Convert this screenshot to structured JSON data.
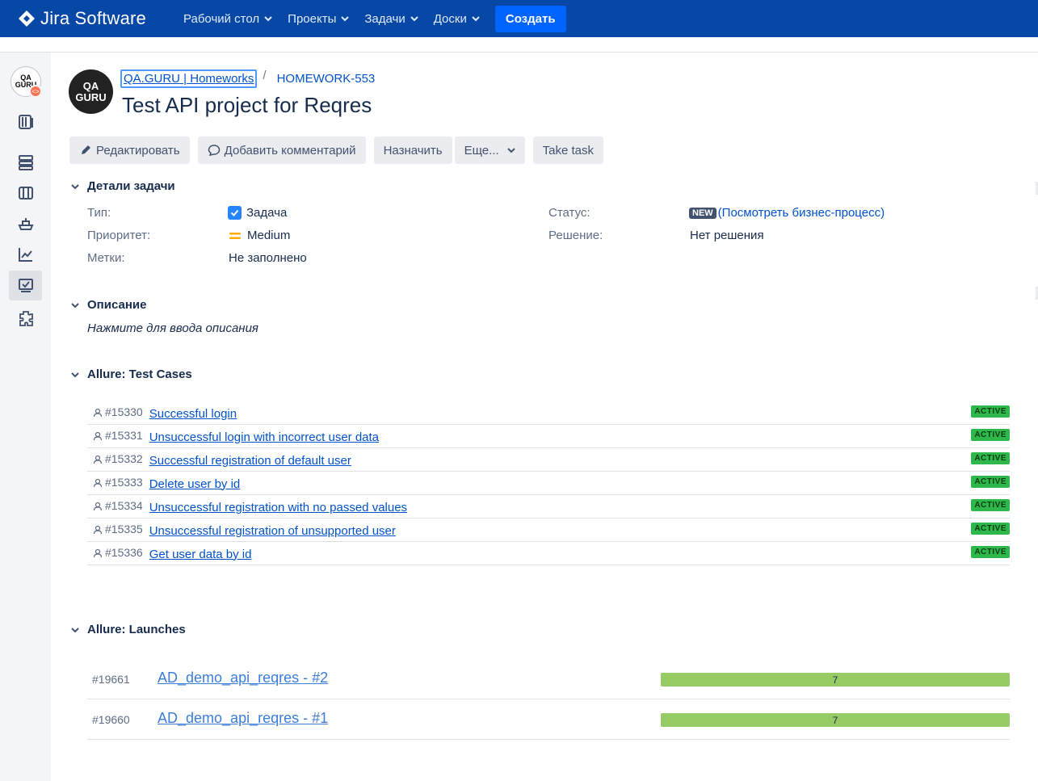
{
  "nav": {
    "brand": "Jira Software",
    "items": [
      {
        "label": "Рабочий стол"
      },
      {
        "label": "Проекты"
      },
      {
        "label": "Задачи"
      },
      {
        "label": "Доски"
      }
    ],
    "create_label": "Создать"
  },
  "sidebar": {
    "avatar_text": "QA GURU",
    "icons": [
      "backlog-icon",
      "releases-icon",
      "board-icon",
      "ship-icon",
      "reports-icon",
      "test-management-icon",
      "addon-icon"
    ]
  },
  "issue": {
    "project_avatar_text": "QA GURU",
    "breadcrumb": {
      "project": "QA.GURU | Homeworks",
      "separator": "/",
      "key": "HOMEWORK-553"
    },
    "title": "Test API project for Reqres"
  },
  "toolbar": {
    "edit_label": "Редактировать",
    "comment_label": "Добавить комментарий",
    "assign_label": "Назначить",
    "more_label": "Еще...",
    "take_task_label": "Take task"
  },
  "details": {
    "heading": "Детали задачи",
    "type_label": "Тип:",
    "type_value": "Задача",
    "priority_label": "Приоритет:",
    "priority_value": "Medium",
    "labels_label": "Метки:",
    "labels_value": "Не заполнено",
    "status_label": "Статус:",
    "status_value": "NEW",
    "workflow_link": "(Посмотреть бизнес-процесс)",
    "resolution_label": "Решение:",
    "resolution_value": "Нет решения"
  },
  "description": {
    "heading": "Описание",
    "placeholder": "Нажмите для ввода описания"
  },
  "test_cases": {
    "heading": "Allure: Test Cases",
    "items": [
      {
        "id": "#15330",
        "name": "Successful login",
        "status": "ACTIVE"
      },
      {
        "id": "#15331",
        "name": "Unsuccessful login with incorrect user data",
        "status": "ACTIVE"
      },
      {
        "id": "#15332",
        "name": "Successful registration of default user",
        "status": "ACTIVE"
      },
      {
        "id": "#15333",
        "name": "Delete user by id",
        "status": "ACTIVE"
      },
      {
        "id": "#15334",
        "name": "Unsuccessful registration with no passed values",
        "status": "ACTIVE"
      },
      {
        "id": "#15335",
        "name": "Unsuccessful registration of unsupported user",
        "status": "ACTIVE"
      },
      {
        "id": "#15336",
        "name": "Get user data by id",
        "status": "ACTIVE"
      }
    ]
  },
  "launches": {
    "heading": "Allure: Launches",
    "items": [
      {
        "id": "#19661",
        "name": "AD_demo_api_reqres - #2",
        "passed": "7"
      },
      {
        "id": "#19660",
        "name": "AD_demo_api_reqres - #1",
        "passed": "7"
      }
    ]
  },
  "colors": {
    "nav_bg": "#0747a6",
    "create_btn": "#0065ff",
    "active_badge": "#2eb84b",
    "launch_bar": "#97cc64"
  }
}
